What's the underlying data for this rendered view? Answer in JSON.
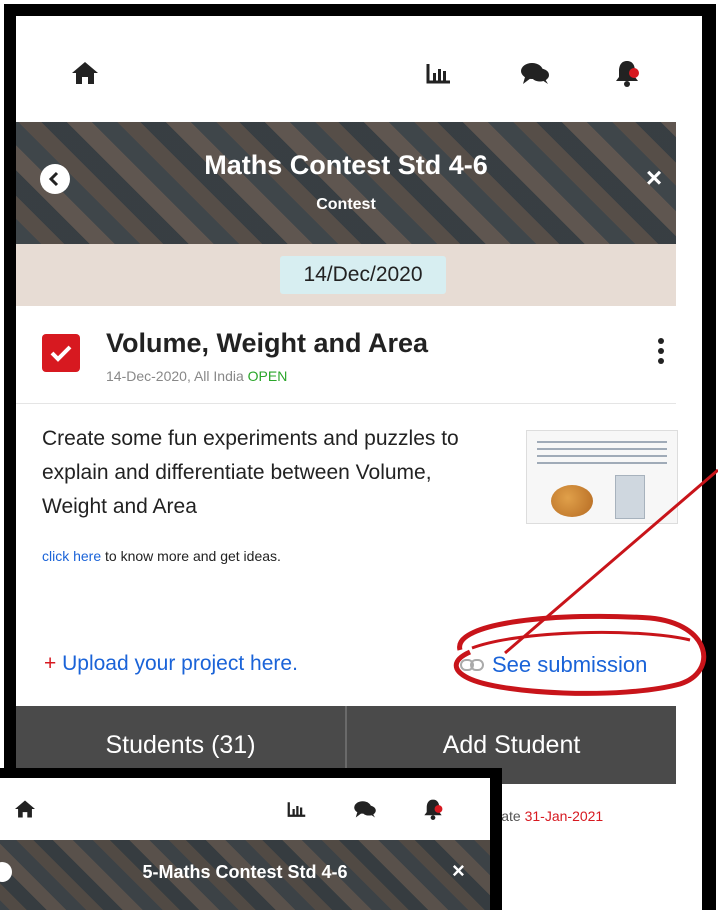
{
  "main": {
    "title": "Maths Contest Std 4-6",
    "subtitle": "Contest",
    "date_chip": "14/Dec/2020",
    "card": {
      "title": "Volume, Weight and Area",
      "meta_prefix": "14-Dec-2020, All India ",
      "status": "OPEN",
      "description": "Create some fun experiments and puzzles to explain and differentiate between Volume, Weight and Area",
      "more_link": "click here",
      "more_suffix": " to know more and get ideas."
    },
    "upload_plus": "+",
    "upload_label": " Upload your project here.",
    "see_submission": "See submission",
    "buttons": {
      "students": "Students (31)",
      "add_student": "Add Student"
    },
    "submission_label": "on date ",
    "submission_date": "31-Jan-2021"
  },
  "overlay": {
    "title": "5-Maths Contest Std 4-6"
  },
  "icons": {
    "home": "home-icon",
    "chart": "bar-chart-icon",
    "chat": "chat-icon",
    "bell": "bell-icon",
    "back": "back-icon",
    "close": "close-icon",
    "check": "checkbox-checked-icon",
    "kebab": "more-vert-icon",
    "link": "link-icon"
  },
  "colors": {
    "accent_red": "#d71920",
    "link_blue": "#1a63d8",
    "open_green": "#2aa62a",
    "button_bar": "#4a4a4a",
    "date_row": "#e7dcd4",
    "date_chip": "#d7eef1"
  }
}
